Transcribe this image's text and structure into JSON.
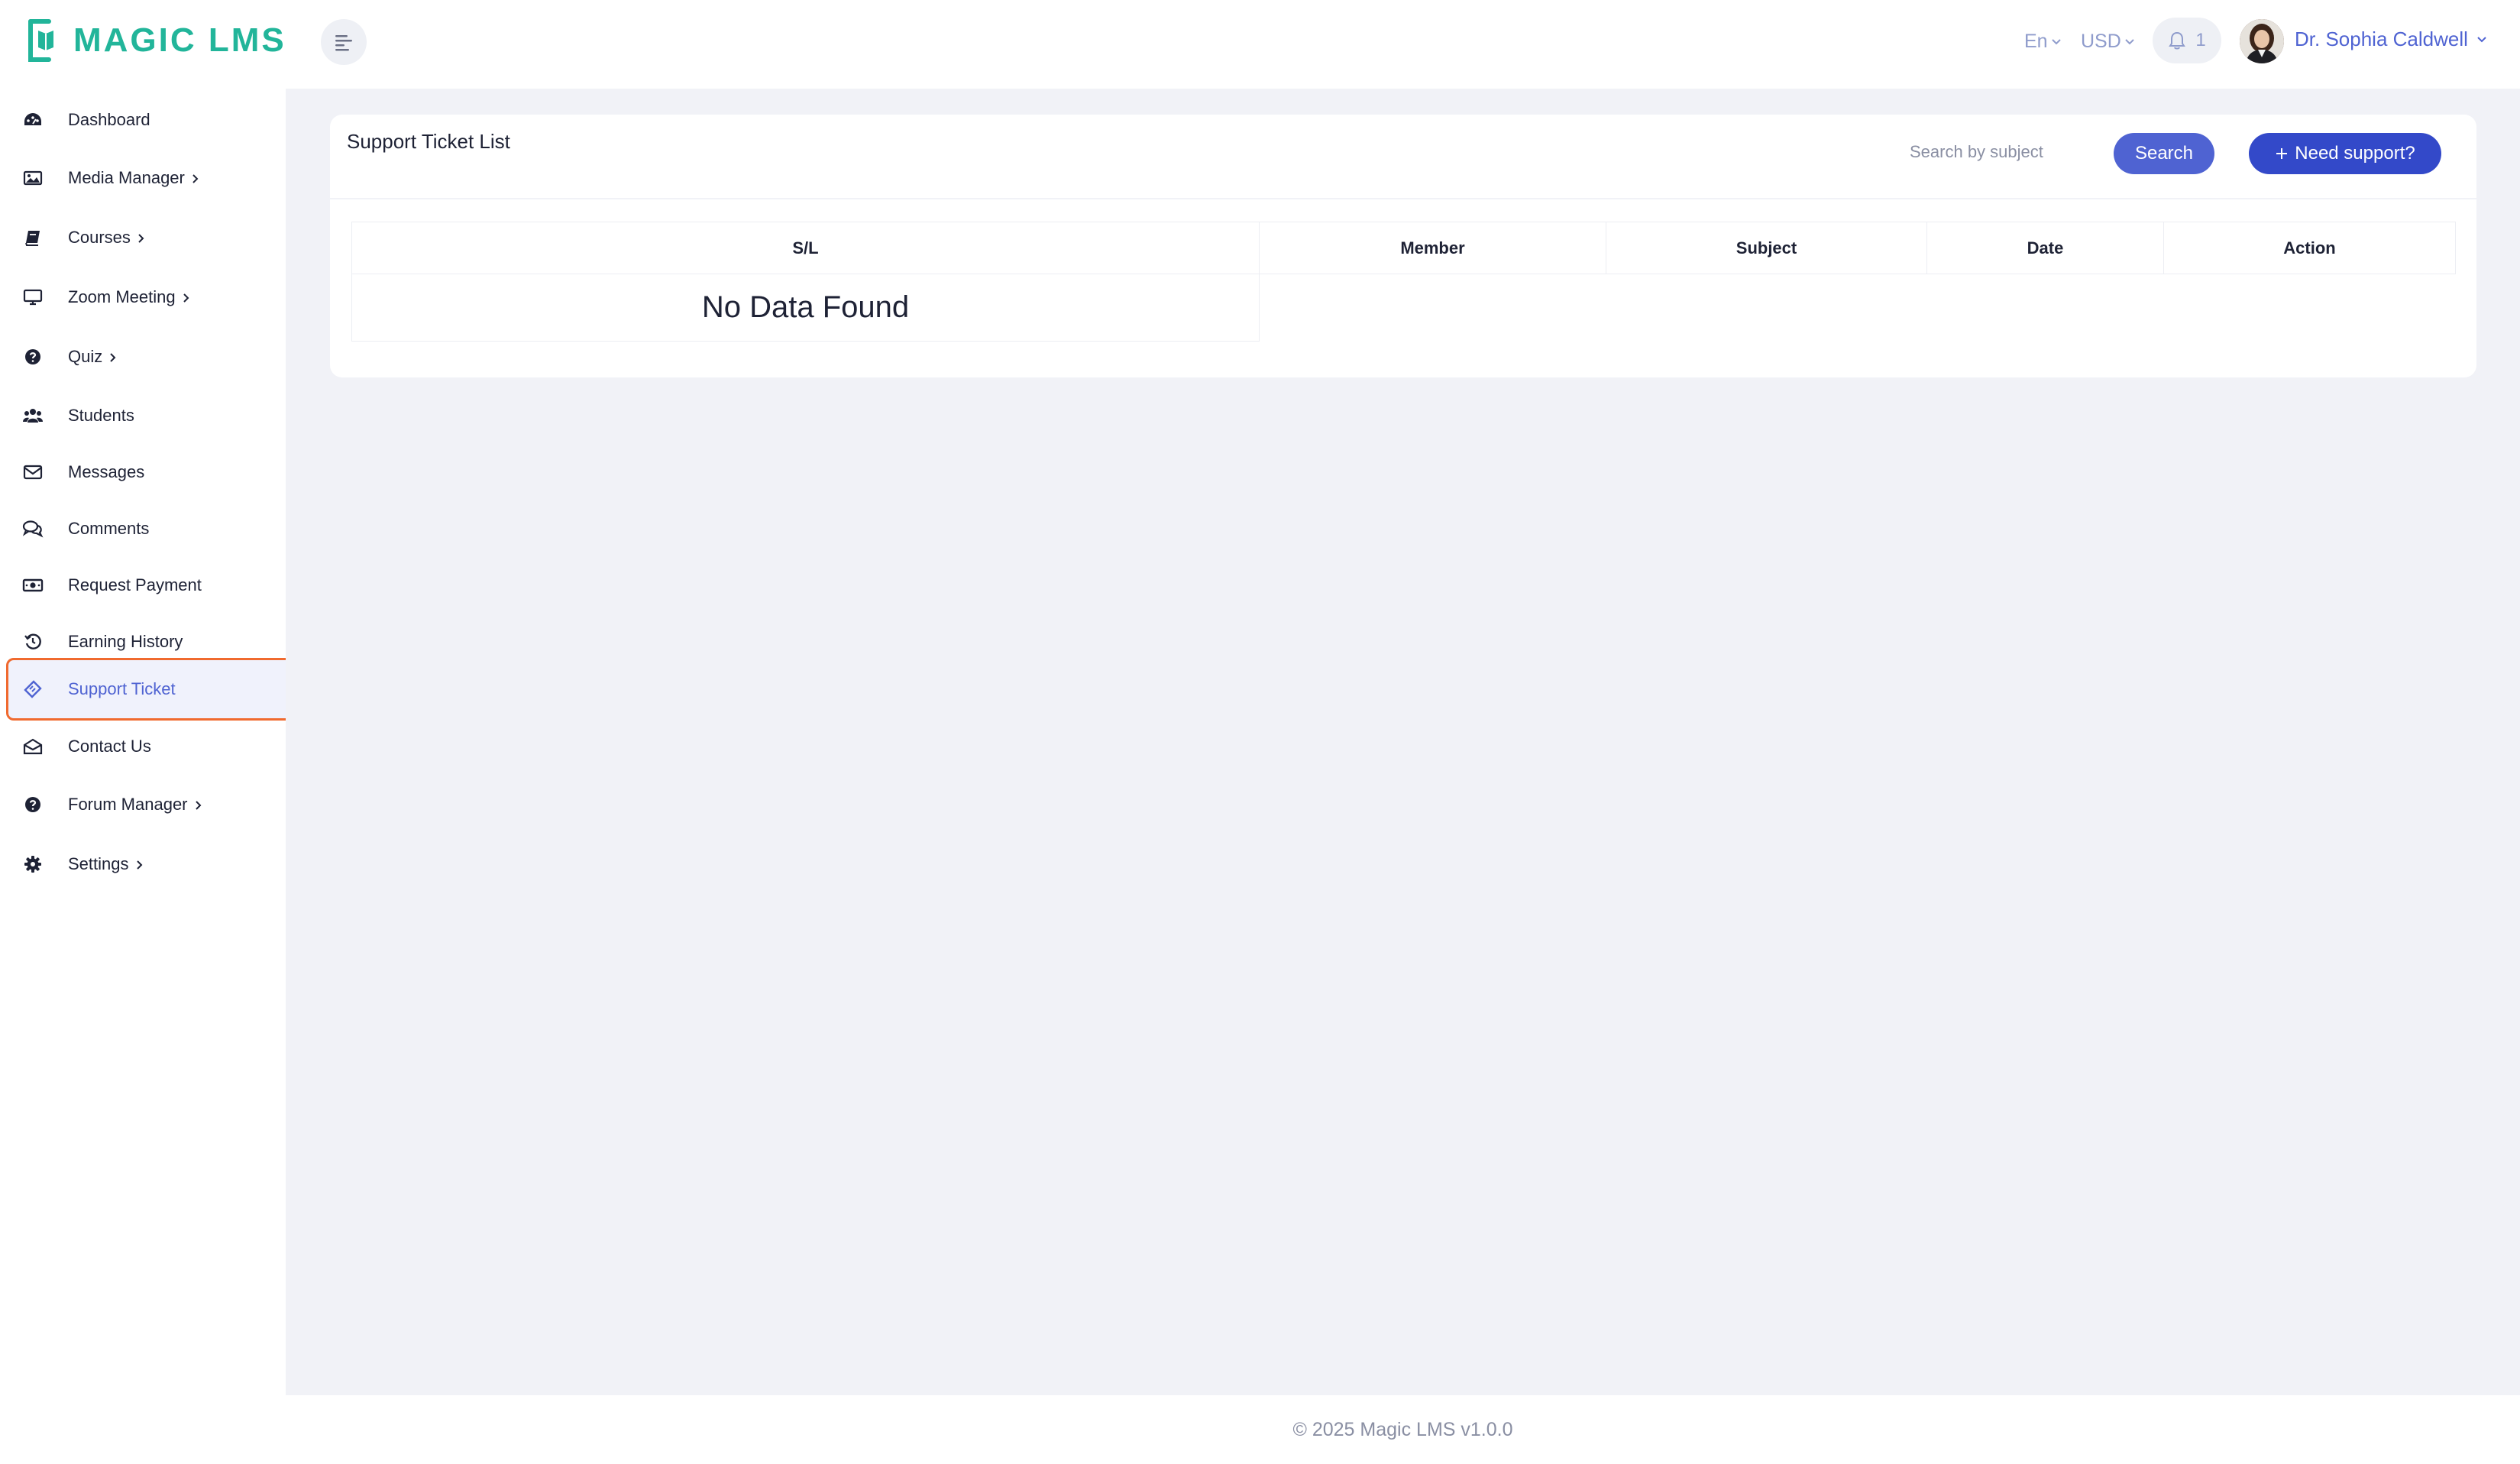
{
  "brand": {
    "name": "MAGIC LMS",
    "color": "#22b59a"
  },
  "header": {
    "language": "En",
    "currency": "USD",
    "notification_count": "1",
    "user_name": "Dr. Sophia Caldwell"
  },
  "sidebar": {
    "items": [
      {
        "label": "Dashboard",
        "icon": "dashboard-icon"
      },
      {
        "label": "Media Manager",
        "icon": "image-icon",
        "has_submenu": true
      },
      {
        "label": "Courses",
        "icon": "book-icon",
        "has_submenu": true
      },
      {
        "label": "Zoom Meeting",
        "icon": "monitor-icon",
        "has_submenu": true
      },
      {
        "label": "Quiz",
        "icon": "question-circle-icon",
        "has_submenu": true
      },
      {
        "label": "Students",
        "icon": "users-icon"
      },
      {
        "label": "Messages",
        "icon": "envelope-icon"
      },
      {
        "label": "Comments",
        "icon": "comments-icon"
      },
      {
        "label": "Request Payment",
        "icon": "money-icon"
      },
      {
        "label": "Earning History",
        "icon": "history-icon"
      },
      {
        "label": "Support Ticket",
        "icon": "ticket-icon",
        "active": true
      },
      {
        "label": "Contact Us",
        "icon": "envelope-open-icon"
      },
      {
        "label": "Forum Manager",
        "icon": "question-circle-icon",
        "has_submenu": true
      },
      {
        "label": "Settings",
        "icon": "gear-icon",
        "has_submenu": true
      }
    ]
  },
  "main": {
    "title": "Support Ticket List",
    "search_placeholder": "Search by subject",
    "search_button": "Search",
    "need_support_button": "Need support?",
    "table": {
      "columns": [
        "S/L",
        "Member",
        "Subject",
        "Date",
        "Action"
      ],
      "empty_message": "No Data Found"
    }
  },
  "footer": {
    "text": "© 2025 Magic LMS v1.0.0"
  },
  "colors": {
    "accent": "#4f63d2",
    "active_outline": "#f06a2f",
    "background": "#f1f2f7"
  }
}
